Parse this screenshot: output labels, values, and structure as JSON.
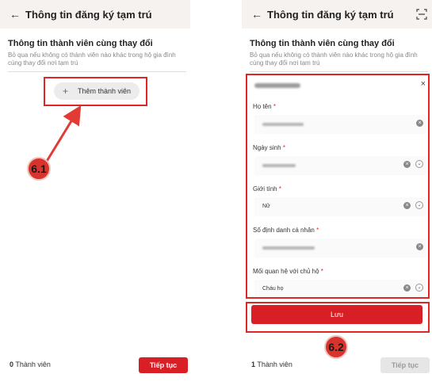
{
  "left": {
    "header": {
      "title": "Thông tin đăng ký tạm trú"
    },
    "section": {
      "title": "Thông tin thành viên cùng thay đổi",
      "description": "Bỏ qua nếu không có thành viên nào khác trong hộ gia đình cùng thay đổi nơi tạm trú"
    },
    "add_member_label": "Thêm thành viên",
    "footer": {
      "count": "0",
      "count_label": "Thành viên",
      "continue_label": "Tiếp tục"
    },
    "step_label": "6.1"
  },
  "right": {
    "header": {
      "title": "Thông tin đăng ký tạm trú"
    },
    "section": {
      "title": "Thông tin thành viên cùng thay đổi",
      "description": "Bỏ qua nếu không có thành viên nào khác trong hộ gia đình cùng thay đổi nơi tạm trú"
    },
    "form": {
      "close_label": "×",
      "fullname_label": "Họ tên",
      "dob_label": "Ngày sinh",
      "gender_label": "Giới tính",
      "gender_value": "Nữ",
      "id_label": "Số định danh cá nhân",
      "relation_label": "Mối quan hệ với chủ hộ",
      "relation_value": "Cháu họ",
      "required_mark": "*"
    },
    "save_label": "Lưu",
    "footer": {
      "count": "1",
      "count_label": "Thành viên",
      "continue_label": "Tiếp tục"
    },
    "step_label": "6.2"
  },
  "colors": {
    "primary": "#d81f26",
    "highlight": "#e02525",
    "header_bg": "#f6f2ef"
  },
  "icons": [
    "back-arrow-icon",
    "scan-icon",
    "plus-icon",
    "close-icon",
    "clear-icon",
    "chevron-down-icon"
  ]
}
